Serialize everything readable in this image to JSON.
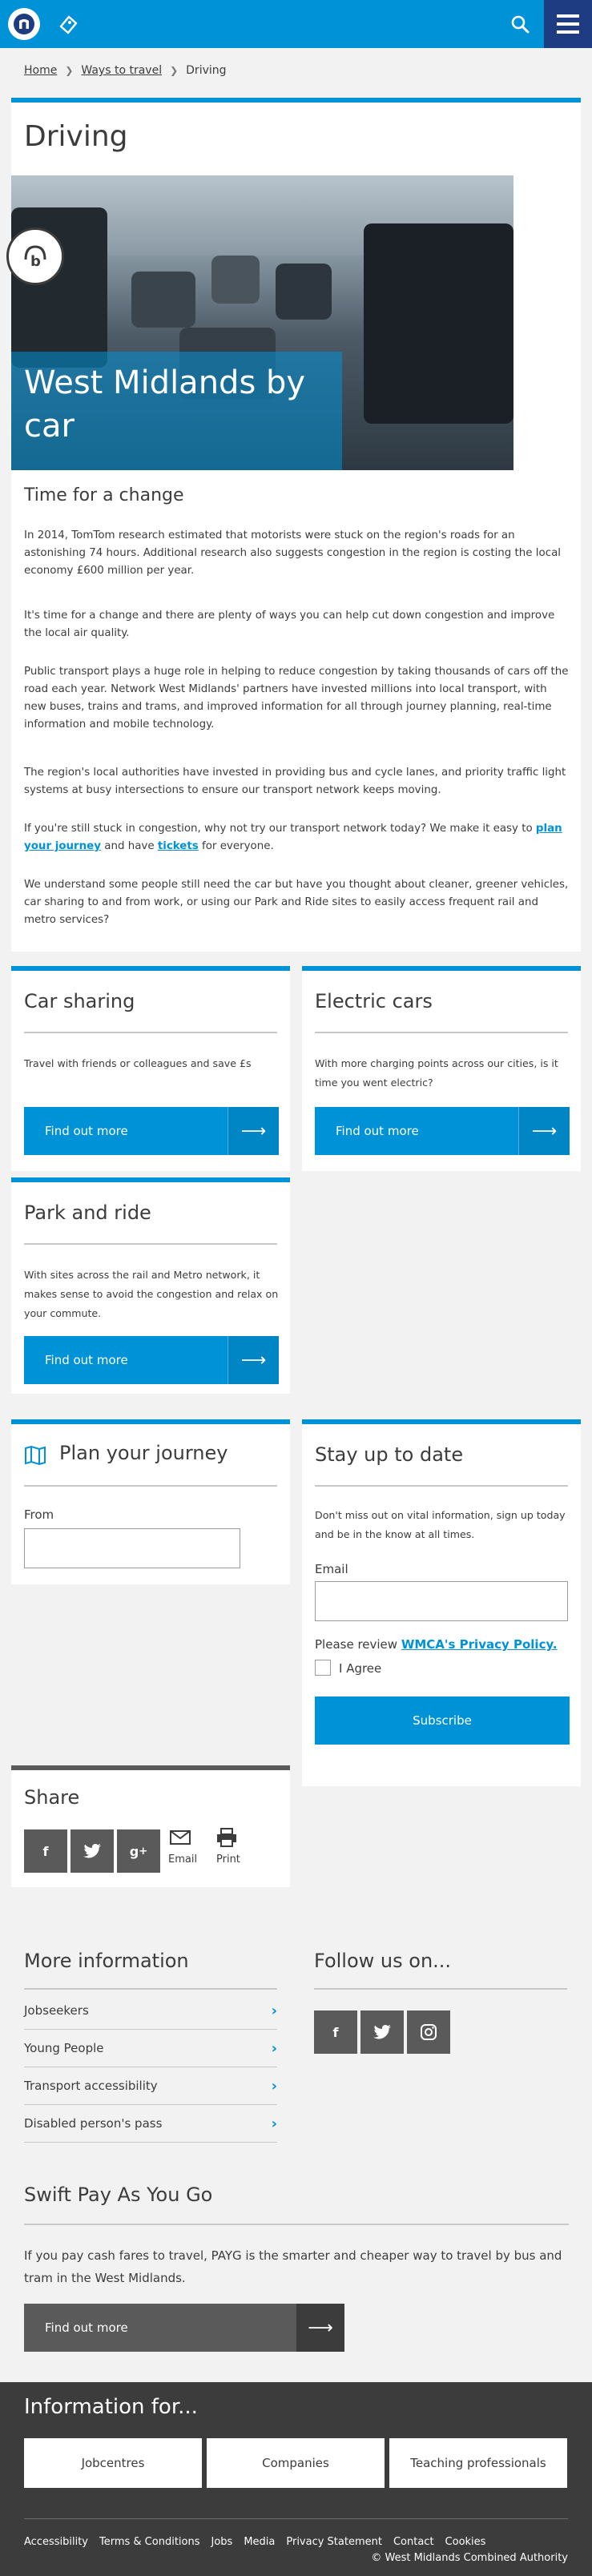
{
  "header": {
    "logo_icon": "network-n-logo",
    "ticket_icon": "ticket-icon",
    "search_icon": "search-icon",
    "menu_icon": "hamburger-menu-icon"
  },
  "breadcrumb": {
    "items": [
      "Home",
      "Ways to travel"
    ],
    "current": "Driving"
  },
  "main": {
    "title": "Driving",
    "hero_title": "West Midlands by car",
    "listen_icon": "browsealoud-icon",
    "section_heading": "Time for a change",
    "paragraphs": [
      "In 2014, TomTom research estimated that motorists were stuck on the region's roads for an astonishing 74 hours. Additional research also suggests congestion in the region is costing the local economy £600 million per year.",
      "It's time for a change and there are plenty of ways you can help cut down congestion and improve the local air quality.",
      "Public transport plays a huge role in helping to reduce congestion by taking thousands of cars off the road each year. Network West Midlands' partners have invested millions into local transport, with new buses, trains and trams, and improved information for all through journey planning, real-time information and mobile technology.",
      "The region's local authorities have invested in providing bus and cycle lanes, and priority traffic light systems at busy intersections to ensure our transport network keeps moving."
    ],
    "para5": {
      "before": "If you're still stuck in congestion, why not try our transport network today? We make it easy to ",
      "link1": "plan your journey",
      "middle": " and have ",
      "link2": "tickets",
      "after": " for everyone."
    },
    "paragraph6": "We understand some people still need the car but have you thought about cleaner, greener vehicles, car sharing to and from work, or using our Park and Ride sites to easily access frequent rail and metro services?"
  },
  "features": [
    {
      "title": "Car sharing",
      "text": "Travel with friends or colleagues and save £s",
      "button": "Find out more"
    },
    {
      "title": "Electric cars",
      "text": "With more charging points across our cities, is it time you went electric?",
      "button": "Find out more"
    },
    {
      "title": "Park and ride",
      "text": "With sites across the rail and Metro network, it makes sense to avoid the congestion and relax on your commute.",
      "button": "Find out more"
    }
  ],
  "plan": {
    "title": "Plan your journey",
    "from_label": "From",
    "from_value": ""
  },
  "stay": {
    "title": "Stay up to date",
    "text": "Don't miss out on vital information, sign up today and be in the know at all times.",
    "email_label": "Email",
    "email_value": "",
    "privacy_prefix": "Please review ",
    "privacy_link": "WMCA's Privacy Policy.",
    "agree_label": "I Agree",
    "subscribe": "Subscribe"
  },
  "share": {
    "title": "Share",
    "email_label": "Email",
    "print_label": "Print"
  },
  "more_info": {
    "title": "More information",
    "links": [
      "Jobseekers",
      "Young People",
      "Transport accessibility",
      "Disabled person's pass"
    ]
  },
  "follow": {
    "title": "Follow us on..."
  },
  "payg": {
    "title": "Swift Pay As You Go",
    "text": "If you pay cash fares to travel, PAYG is the smarter and cheaper way to travel by bus and tram in the West Midlands.",
    "button": "Find out more"
  },
  "footer": {
    "title": "Information for...",
    "boxes": [
      "Jobcentres",
      "Companies",
      "Teaching professionals"
    ],
    "links": [
      "Accessibility",
      "Terms & Conditions",
      "Jobs",
      "Media",
      "Privacy Statement",
      "Contact",
      "Cookies"
    ],
    "copyright": "© West Midlands Combined Authority"
  },
  "colors": {
    "brand_blue": "#0092d6",
    "navy": "#1d3c81",
    "dark_grey": "#3c3c3c",
    "mid_grey": "#5a5a5a"
  }
}
